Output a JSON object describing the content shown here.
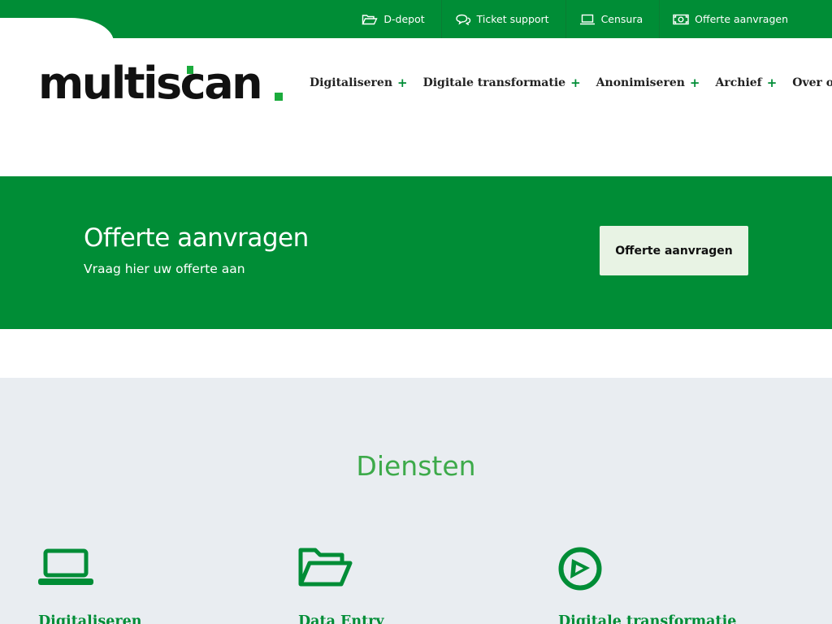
{
  "colors": {
    "brand_green": "#008d36",
    "accent_green": "#3daa4a",
    "button_bg": "#e8f3e4",
    "services_bg": "#e9edf1"
  },
  "topbar": {
    "links": [
      {
        "icon": "folder-open-icon",
        "label": "D-depot"
      },
      {
        "icon": "chat-bubbles-icon",
        "label": "Ticket support"
      },
      {
        "icon": "laptop-icon",
        "label": "Censura"
      },
      {
        "icon": "money-bill-icon",
        "label": "Offerte aanvragen"
      }
    ]
  },
  "header": {
    "logo_text": "multiscan",
    "nav": [
      {
        "label": "Digitaliseren",
        "expand": "+"
      },
      {
        "label": "Digitale transformatie",
        "expand": "+"
      },
      {
        "label": "Anonimiseren",
        "expand": "+"
      },
      {
        "label": "Archief",
        "expand": "+"
      },
      {
        "label": "Over ons",
        "expand": "+"
      }
    ]
  },
  "banner": {
    "title": "Offerte aanvragen",
    "subtitle": "Vraag hier uw offerte aan",
    "button_label": "Offerte aanvragen"
  },
  "services": {
    "title": "Diensten",
    "items": [
      {
        "icon": "laptop-icon",
        "label": "Digitaliseren"
      },
      {
        "icon": "folder-open-icon",
        "label": "Data Entry"
      },
      {
        "icon": "compass-icon",
        "label": "Digitale transformatie"
      }
    ]
  }
}
